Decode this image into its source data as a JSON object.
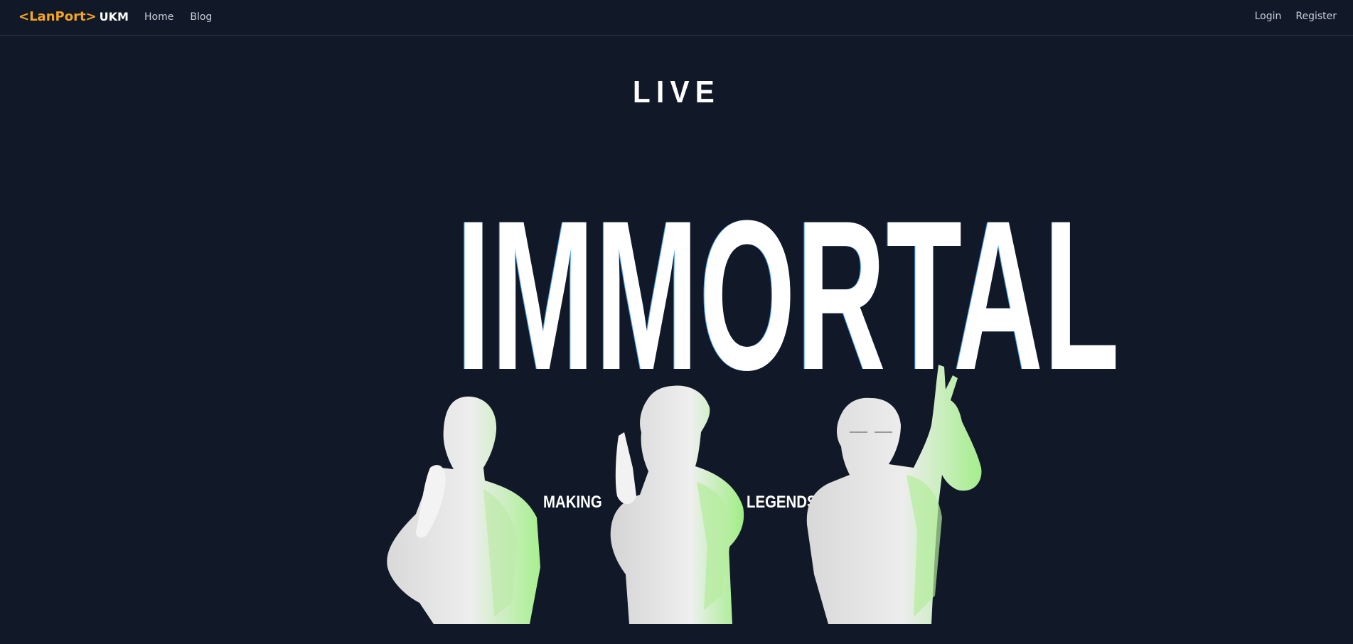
{
  "navbar": {
    "brand": {
      "accent": "<LanPort>",
      "suffix": "UKM"
    },
    "links": [
      "Home",
      "Blog"
    ],
    "auth": [
      "Login",
      "Register"
    ]
  },
  "hero": {
    "top_word": "LIVE",
    "main_word": "IMMORTAL",
    "tagline_left": "MAKING",
    "tagline_right": "LEGENDS"
  },
  "colors": {
    "background": "#111827",
    "brand_accent": "#f5a524",
    "statue_highlight": "#8ff07a"
  }
}
